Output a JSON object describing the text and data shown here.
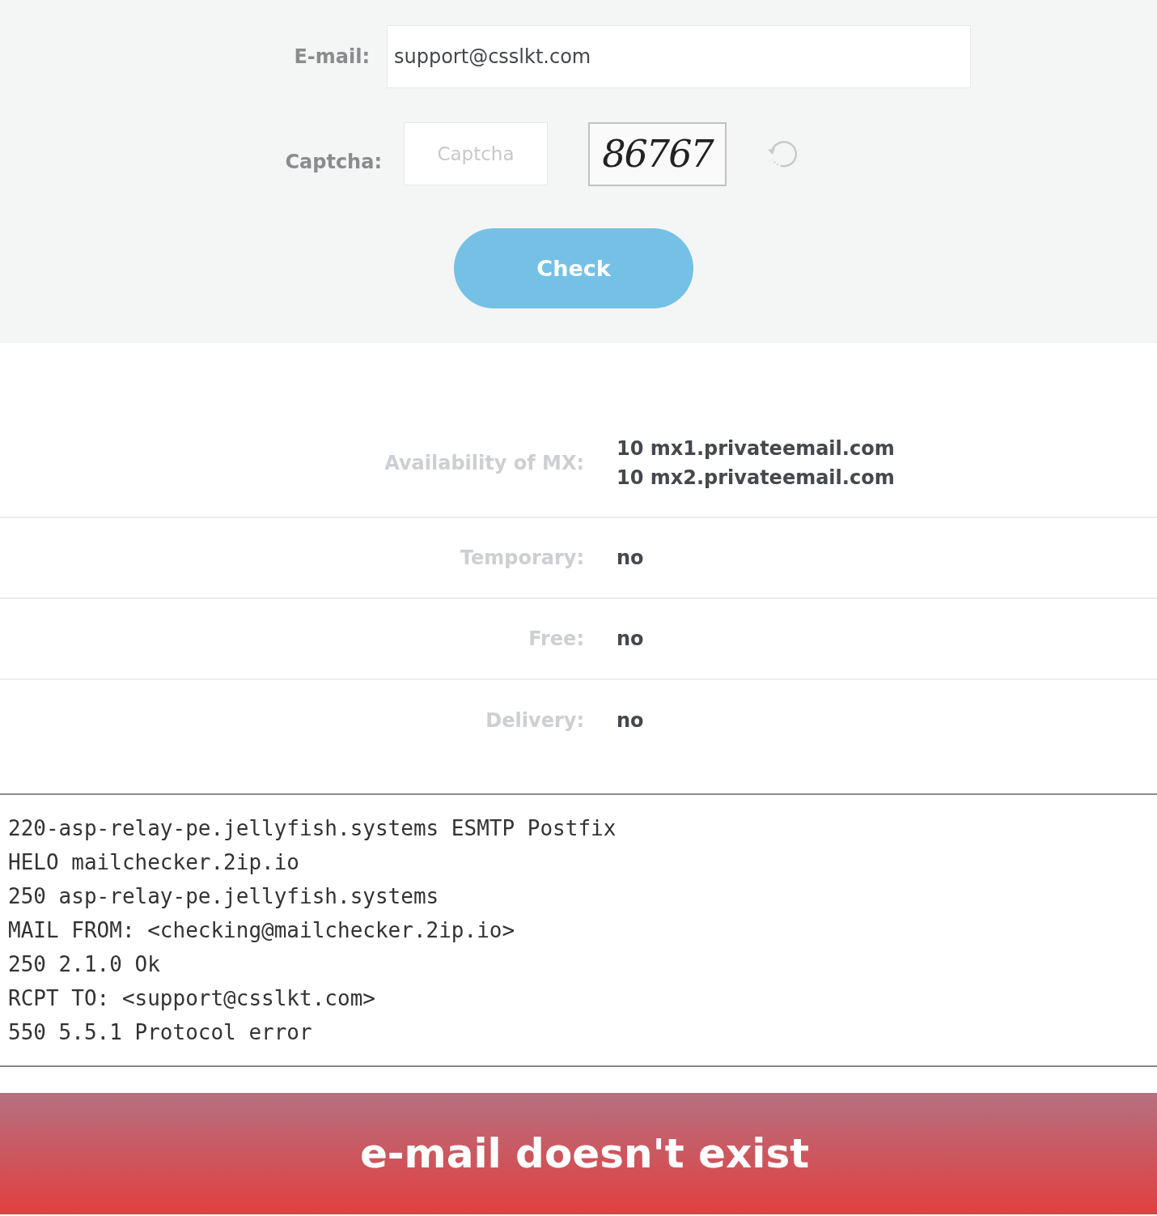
{
  "form": {
    "email": {
      "label": "E-mail:",
      "value": "support@csslkt.com"
    },
    "captcha": {
      "label": "Captcha:",
      "placeholder": "Captcha",
      "image_text": "86767"
    },
    "button": "Check"
  },
  "results": [
    {
      "label": "Availability of MX:",
      "values": [
        "10 mx1.privateemail.com",
        "10 mx2.privateemail.com"
      ]
    },
    {
      "label": "Temporary:",
      "values": [
        "no"
      ]
    },
    {
      "label": "Free:",
      "values": [
        "no"
      ]
    },
    {
      "label": "Delivery:",
      "values": [
        "no"
      ]
    }
  ],
  "log": [
    "220-asp-relay-pe.jellyfish.systems ESMTP Postfix",
    "HELO mailchecker.2ip.io",
    "250 asp-relay-pe.jellyfish.systems",
    "MAIL FROM: <checking@mailchecker.2ip.io>",
    "250 2.1.0 Ok",
    "RCPT TO: <support@csslkt.com>",
    "550 5.5.1 Protocol error"
  ],
  "verdict": {
    "text": "e-mail doesn't exist",
    "exists": false
  }
}
